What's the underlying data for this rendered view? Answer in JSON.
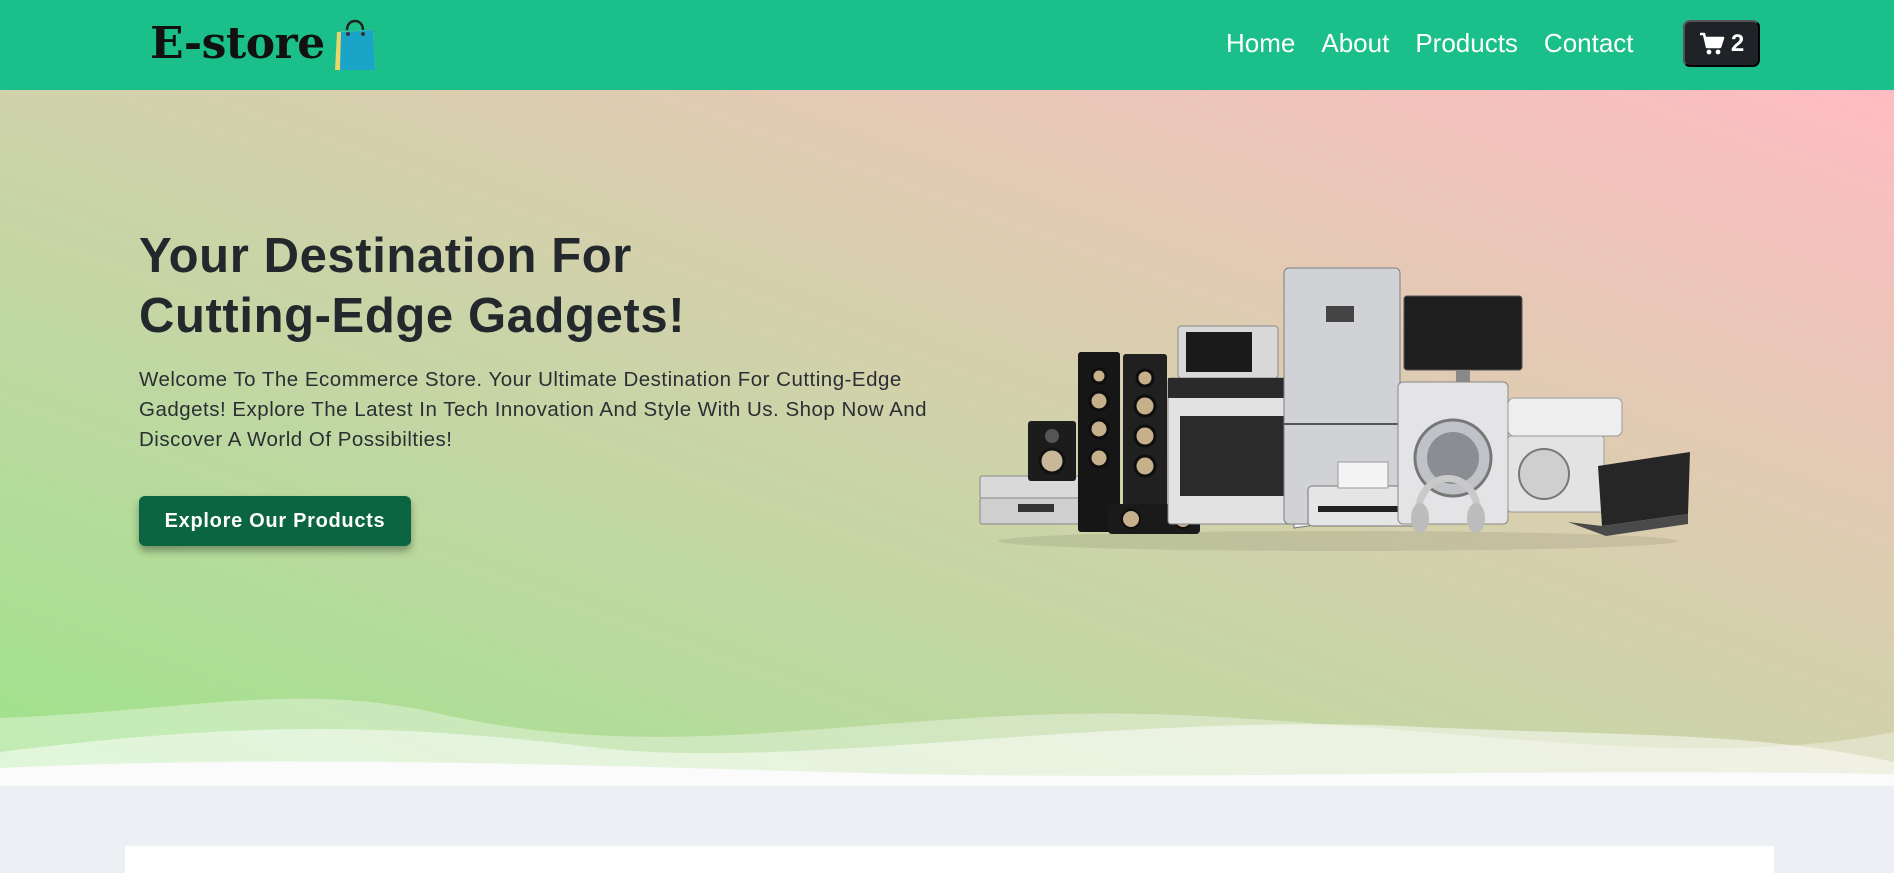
{
  "brand": {
    "name": "E-store",
    "icon": "shopping-bag-icon"
  },
  "nav": {
    "links": [
      {
        "label": "Home"
      },
      {
        "label": "About"
      },
      {
        "label": "Products"
      },
      {
        "label": "Contact"
      }
    ],
    "cart": {
      "icon": "shopping-cart-icon",
      "count": "2"
    }
  },
  "hero": {
    "title": "Your Destination For Cutting-Edge Gadgets!",
    "description": "Welcome To The Ecommerce Store. Your Ultimate Destination For Cutting-Edge Gadgets! Explore The Latest In Tech Innovation And Style With Us. Shop Now And Discover A World Of Possibilties!",
    "cta_label": "Explore Our Products",
    "image": "electronics-appliances-image"
  },
  "colors": {
    "navbar": "#1bbf8a",
    "cta": "#0b6540",
    "cart_button": "#1f2327",
    "page_bg": "#eceff3"
  }
}
